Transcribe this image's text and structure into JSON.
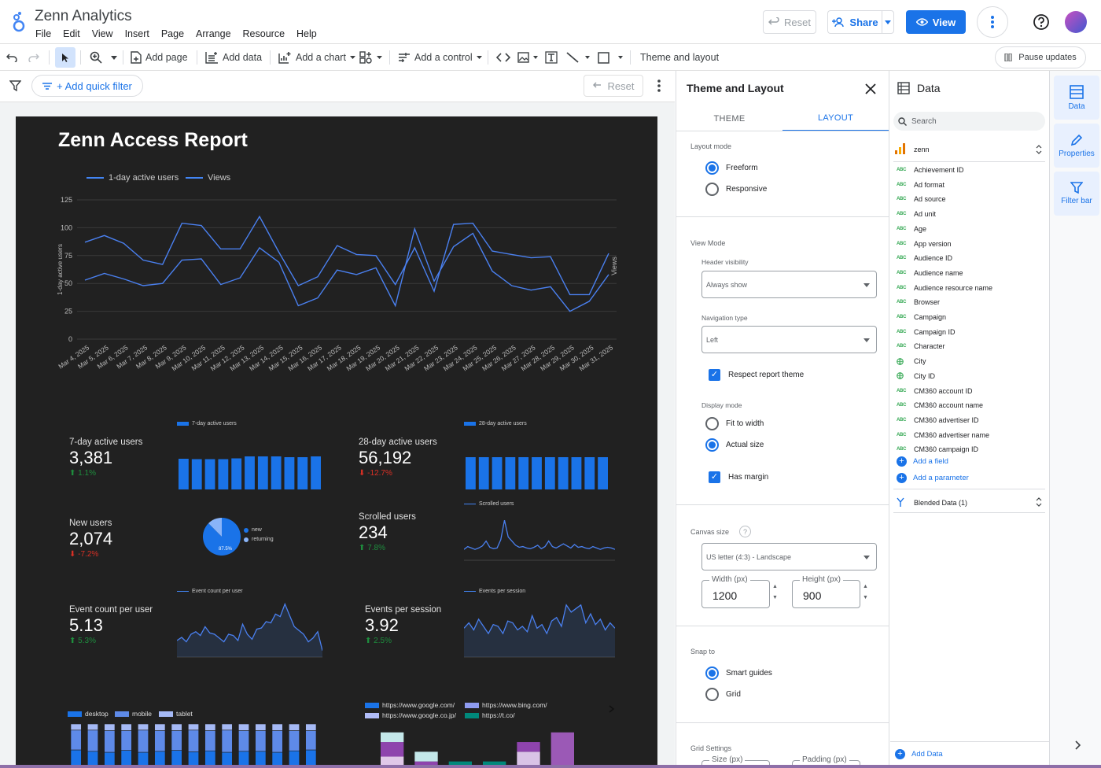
{
  "app": {
    "title": "Zenn Analytics"
  },
  "menu": [
    "File",
    "Edit",
    "View",
    "Insert",
    "Page",
    "Arrange",
    "Resource",
    "Help"
  ],
  "header_buttons": {
    "reset": "Reset",
    "share": "Share",
    "view": "View"
  },
  "toolbar": {
    "add_page": "Add page",
    "add_data": "Add data",
    "add_chart": "Add a chart",
    "add_control": "Add a control",
    "theme_layout": "Theme and layout",
    "pause": "Pause updates"
  },
  "filter_bar": {
    "add_quick_filter": "+ Add quick filter",
    "reset": "Reset"
  },
  "report": {
    "title": "Zenn Access Report",
    "timeseries": {
      "legend": [
        "1-day active users",
        "Views"
      ],
      "ylabel_left": "1-day active users",
      "ylabel_right": "Views",
      "yticks": [
        "125",
        "100",
        "75",
        "50",
        "25",
        "0"
      ]
    },
    "scorecards": [
      {
        "label": "7-day active users",
        "value": "3,381",
        "delta": "1.1%",
        "dir": "up",
        "chart_label": "7-day active users"
      },
      {
        "label": "28-day active users",
        "value": "56,192",
        "delta": "-12.7%",
        "dir": "down",
        "chart_label": "28-day active users"
      },
      {
        "label": "New users",
        "value": "2,074",
        "delta": "-7.2%",
        "dir": "down"
      },
      {
        "label": "Scrolled users",
        "value": "234",
        "delta": "7.8%",
        "dir": "up",
        "chart_label": "Scrolled users"
      },
      {
        "label": "Event count per user",
        "value": "5.13",
        "delta": "5.3%",
        "dir": "up",
        "chart_label": "Event count per user"
      },
      {
        "label": "Events per session",
        "value": "3.92",
        "delta": "2.5%",
        "dir": "up",
        "chart_label": "Events per session"
      }
    ],
    "pie": {
      "legend": [
        "new",
        "returning"
      ],
      "label": "87.5%"
    },
    "device_legend": [
      "desktop",
      "mobile",
      "tablet"
    ],
    "referrer_legend": [
      "https://www.google.com/",
      "https://www.bing.com/",
      "https://www.google.co.jp/",
      "https://t.co/"
    ]
  },
  "chart_data": [
    {
      "type": "line",
      "x": [
        "Mar 4, 2025",
        "Mar 5, 2025",
        "Mar 6, 2025",
        "Mar 7, 2025",
        "Mar 8, 2025",
        "Mar 9, 2025",
        "Mar 10, 2025",
        "Mar 11, 2025",
        "Mar 12, 2025",
        "Mar 13, 2025",
        "Mar 14, 2025",
        "Mar 15, 2025",
        "Mar 16, 2025",
        "Mar 17, 2025",
        "Mar 18, 2025",
        "Mar 19, 2025",
        "Mar 20, 2025",
        "Mar 21, 2025",
        "Mar 22, 2025",
        "Mar 23, 2025",
        "Mar 24, 2025",
        "Mar 25, 2025",
        "Mar 26, 2025",
        "Mar 27, 2025",
        "Mar 28, 2025",
        "Mar 29, 2025",
        "Mar 30, 2025",
        "Mar 31, 2025"
      ],
      "series": [
        {
          "name": "1-day active users",
          "values": [
            87,
            93,
            86,
            71,
            67,
            104,
            102,
            81,
            81,
            110,
            78,
            48,
            56,
            84,
            76,
            75,
            49,
            82,
            43,
            103,
            104,
            79,
            76,
            73,
            74,
            40,
            40,
            77
          ]
        },
        {
          "name": "Views",
          "values": [
            53,
            59,
            54,
            48,
            50,
            71,
            72,
            49,
            55,
            82,
            69,
            30,
            37,
            62,
            58,
            64,
            30,
            99,
            52,
            83,
            95,
            61,
            48,
            44,
            47,
            25,
            34,
            58
          ]
        }
      ],
      "ylim": [
        0,
        125
      ],
      "ylabel": "1-day active users"
    },
    {
      "type": "bar",
      "name": "7-day active users",
      "values": [
        78,
        77,
        77,
        77,
        79,
        84,
        84,
        84,
        82,
        82,
        84
      ]
    },
    {
      "type": "bar",
      "name": "28-day active users",
      "values": [
        82,
        82,
        82,
        82,
        82,
        82,
        82,
        82,
        82,
        82,
        82
      ]
    },
    {
      "type": "pie",
      "labels": [
        "new",
        "returning"
      ],
      "values": [
        87.5,
        12.5
      ]
    },
    {
      "type": "line",
      "name": "Scrolled users",
      "values": [
        10,
        14,
        12,
        10,
        12,
        15,
        22,
        13,
        11,
        12,
        24,
        52,
        28,
        22,
        16,
        13,
        14,
        12,
        11,
        13,
        16,
        11,
        14,
        22,
        14,
        12,
        15,
        18,
        15,
        12,
        17,
        13,
        14,
        12,
        11,
        14,
        12,
        10,
        12,
        13,
        12,
        10
      ]
    },
    {
      "type": "line",
      "name": "Event count per user",
      "values": [
        20,
        25,
        18,
        30,
        34,
        28,
        42,
        32,
        30,
        24,
        18,
        30,
        28,
        20,
        46,
        30,
        22,
        38,
        40,
        50,
        48,
        62,
        58,
        78,
        60,
        42,
        36,
        30,
        18,
        24,
        34,
        4
      ]
    },
    {
      "type": "line",
      "name": "Events per session",
      "values": [
        28,
        34,
        26,
        38,
        30,
        22,
        32,
        30,
        22,
        36,
        34,
        26,
        30,
        24,
        42,
        28,
        32,
        22,
        36,
        40,
        30,
        54,
        46,
        50,
        54,
        34,
        44,
        32,
        38,
        26,
        34,
        28
      ]
    },
    {
      "type": "bar",
      "name": "Device",
      "series": [
        {
          "name": "desktop",
          "values": [
            45,
            42,
            40,
            44,
            40,
            42,
            44,
            41,
            43,
            40,
            42,
            42,
            40,
            43,
            45
          ]
        },
        {
          "name": "mobile",
          "values": [
            42,
            45,
            46,
            42,
            47,
            44,
            42,
            46,
            43,
            47,
            44,
            44,
            46,
            43,
            41
          ]
        },
        {
          "name": "tablet",
          "values": [
            13,
            13,
            14,
            14,
            13,
            14,
            14,
            13,
            14,
            13,
            14,
            14,
            14,
            14,
            14
          ]
        }
      ]
    },
    {
      "type": "bar",
      "name": "Referrer",
      "series": [
        {
          "name": "https://www.google.com/",
          "values": [
            30,
            40,
            60,
            60,
            40,
            20
          ]
        },
        {
          "name": "https://www.bing.com/",
          "values": [
            30,
            20,
            20,
            20,
            20,
            40
          ]
        },
        {
          "name": "https://www.google.co.jp/",
          "values": [
            20,
            20,
            10,
            10,
            20,
            20
          ]
        },
        {
          "name": "https://t.co/",
          "values": [
            20,
            20,
            10,
            10,
            20,
            20
          ]
        }
      ]
    }
  ],
  "theme_panel": {
    "title": "Theme and Layout",
    "tabs": [
      "THEME",
      "LAYOUT"
    ],
    "layout_mode_label": "Layout mode",
    "layout_modes": [
      "Freeform",
      "Responsive"
    ],
    "view_mode_label": "View Mode",
    "header_visibility_label": "Header visibility",
    "header_visibility_value": "Always show",
    "navigation_type_label": "Navigation type",
    "navigation_type_value": "Left",
    "respect_theme": "Respect report theme",
    "display_mode_label": "Display mode",
    "display_modes": [
      "Fit to width",
      "Actual size"
    ],
    "has_margin": "Has margin",
    "canvas_size_label": "Canvas size",
    "canvas_size_value": "US letter (4:3) - Landscape",
    "width_label": "Width (px)",
    "width_value": "1200",
    "height_label": "Height (px)",
    "height_value": "900",
    "snap_to_label": "Snap to",
    "snap_modes": [
      "Smart guides",
      "Grid"
    ],
    "grid_settings_label": "Grid Settings",
    "size_label": "Size (px)",
    "padding_label": "Padding (px)"
  },
  "data_panel": {
    "title": "Data",
    "search_placeholder": "Search",
    "source": "zenn",
    "fields": [
      {
        "type": "ABC",
        "name": "Achievement ID"
      },
      {
        "type": "ABC",
        "name": "Ad format"
      },
      {
        "type": "ABC",
        "name": "Ad source"
      },
      {
        "type": "ABC",
        "name": "Ad unit"
      },
      {
        "type": "ABC",
        "name": "Age"
      },
      {
        "type": "ABC",
        "name": "App version"
      },
      {
        "type": "ABC",
        "name": "Audience ID"
      },
      {
        "type": "ABC",
        "name": "Audience name"
      },
      {
        "type": "ABC",
        "name": "Audience resource name"
      },
      {
        "type": "ABC",
        "name": "Browser"
      },
      {
        "type": "ABC",
        "name": "Campaign"
      },
      {
        "type": "ABC",
        "name": "Campaign ID"
      },
      {
        "type": "ABC",
        "name": "Character"
      },
      {
        "type": "geo",
        "name": "City"
      },
      {
        "type": "geo",
        "name": "City ID"
      },
      {
        "type": "ABC",
        "name": "CM360 account ID"
      },
      {
        "type": "ABC",
        "name": "CM360 account name"
      },
      {
        "type": "ABC",
        "name": "CM360 advertiser ID"
      },
      {
        "type": "ABC",
        "name": "CM360 advertiser name"
      },
      {
        "type": "ABC",
        "name": "CM360 campaign ID"
      }
    ],
    "add_field": "Add a field",
    "add_parameter": "Add a parameter",
    "blended": "Blended Data (1)",
    "add_data": "Add Data"
  },
  "side_rail": [
    "Data",
    "Properties",
    "Filter bar"
  ],
  "colors": {
    "accent": "#1a73e8",
    "report_bg": "#212121",
    "line_blue": "#4285f4",
    "up": "#1e8e3e",
    "down": "#d93025"
  }
}
